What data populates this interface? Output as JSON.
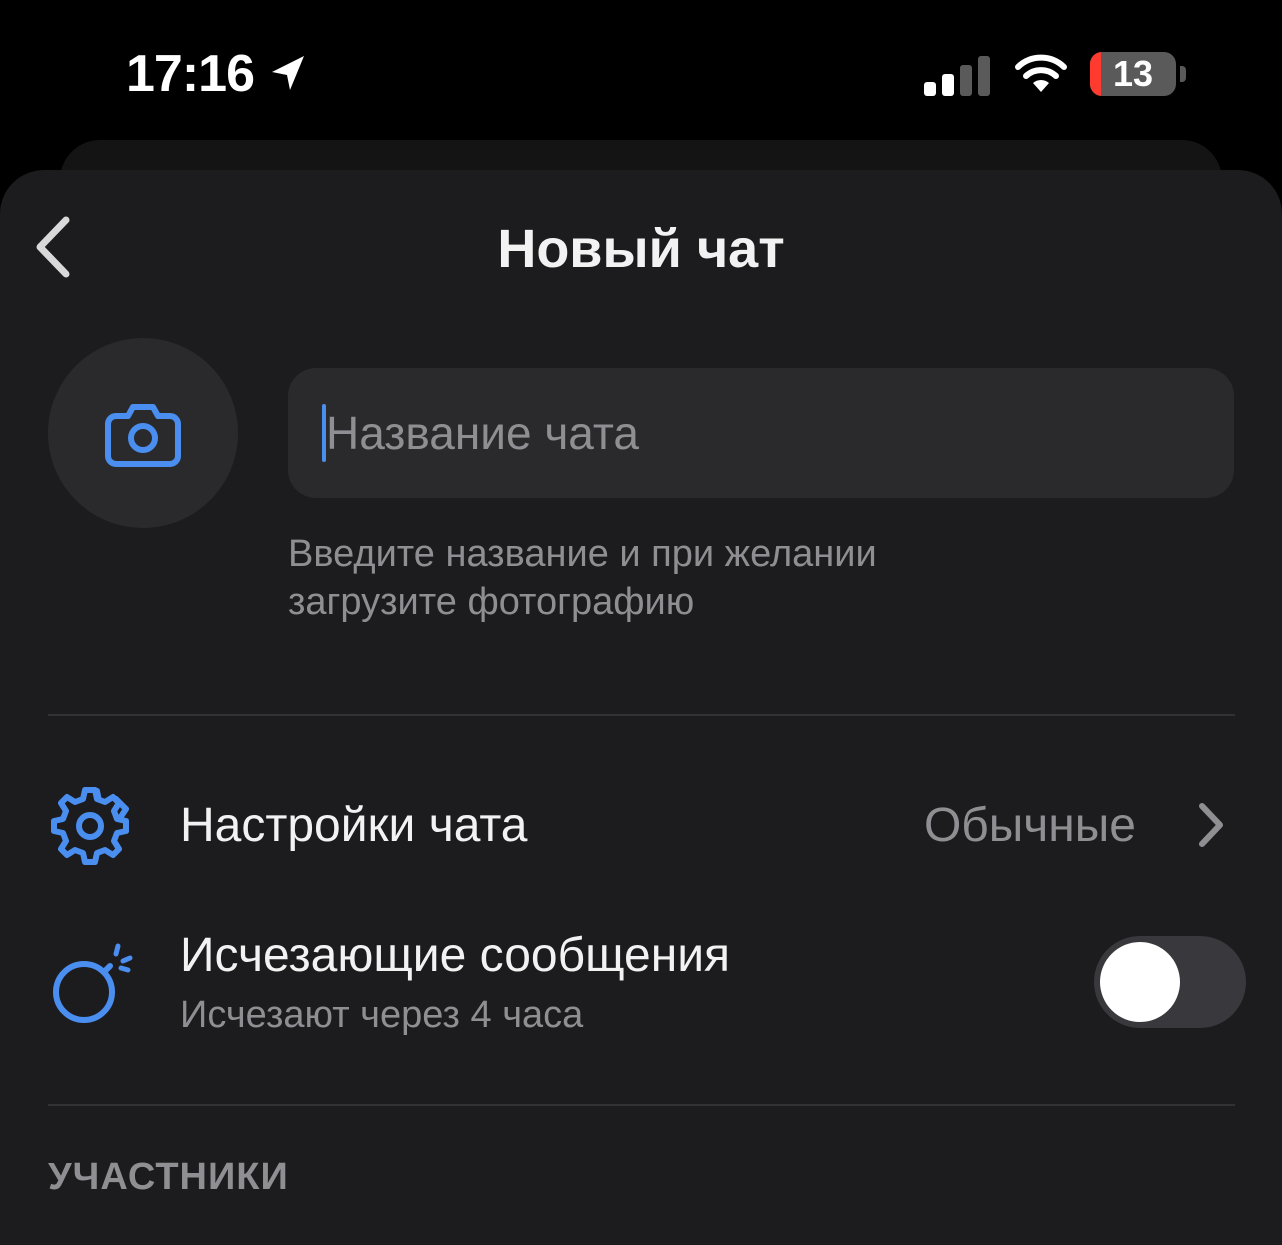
{
  "status_bar": {
    "time": "17:16",
    "battery_level": "13",
    "battery_fraction": 0.13,
    "icons": [
      "location-arrow-icon",
      "cellular-signal-icon",
      "wifi-icon",
      "battery-icon"
    ],
    "signal_bars_active": 2,
    "signal_bars_total": 4
  },
  "header": {
    "title": "Новый чат",
    "back_icon": "chevron-left-icon"
  },
  "chat_info": {
    "photo_icon": "camera-icon",
    "name_placeholder": "Название чата",
    "name_value": "",
    "hint_line1": "Введите название и при желании",
    "hint_line2": "загрузите фотографию"
  },
  "settings": {
    "chat_settings": {
      "icon": "gear-icon",
      "label": "Настройки чата",
      "value": "Обычные"
    },
    "disappearing": {
      "icon": "bomb-icon",
      "label": "Исчезающие сообщения",
      "sublabel": "Исчезают через 4 часа",
      "enabled": false
    }
  },
  "members": {
    "section_title": "УЧАСТНИКИ"
  },
  "colors": {
    "accent": "#4a8ef0",
    "background": "#1c1c1e",
    "secondary_text": "#8e8e93",
    "battery_low": "#ff3b30"
  }
}
